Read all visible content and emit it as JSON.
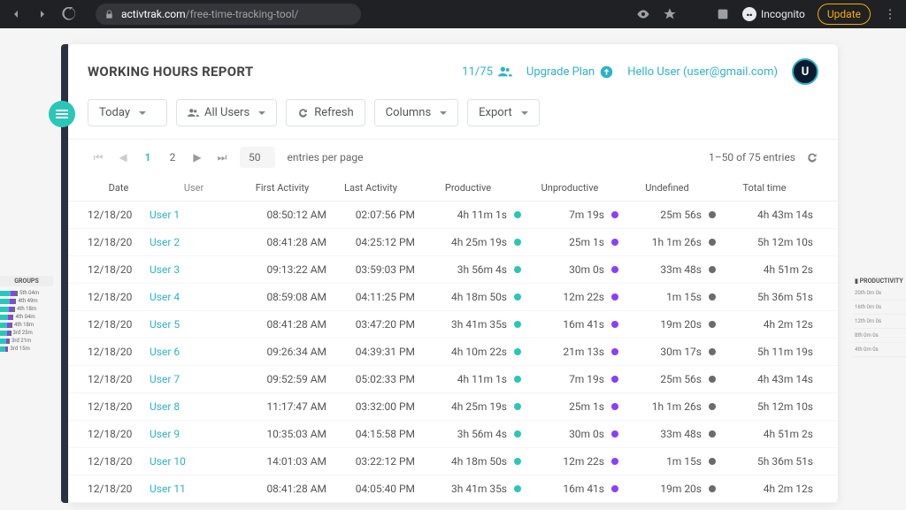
{
  "browser": {
    "url_domain": "activtrak.com",
    "url_path": "/free-time-tracking-tool/",
    "incognito": "Incognito",
    "update": "Update"
  },
  "header": {
    "title": "WORKING HOURS REPORT",
    "users_count": "11/75",
    "upgrade": "Upgrade Plan",
    "hello": "Hello User",
    "email": "(user@gmail.com)",
    "avatar_initial": "U"
  },
  "toolbar": {
    "timeframe": "Today",
    "users_filter": "All Users",
    "refresh": "Refresh",
    "columns": "Columns",
    "export": "Export"
  },
  "pager": {
    "page1": "1",
    "page2": "2",
    "per_page": "50",
    "per_page_label": "entries per page",
    "range": "1–50 of 75 entries"
  },
  "columns": {
    "date": "Date",
    "user": "User",
    "first": "First Activity",
    "last": "Last Activity",
    "productive": "Productive",
    "unproductive": "Unproductive",
    "undefined": "Undefined",
    "total": "Total time"
  },
  "rows": [
    {
      "date": "12/18/20",
      "user": "User 1",
      "first": "08:50:12 AM",
      "last": "02:07:56 PM",
      "prod": "4h 11m 1s",
      "unprod": "7m 19s",
      "undef": "25m 56s",
      "total": "4h 43m 14s"
    },
    {
      "date": "12/18/20",
      "user": "User 2",
      "first": "08:41:28 AM",
      "last": "04:25:12 PM",
      "prod": "4h 25m 19s",
      "unprod": "25m 1s",
      "undef": "1h 1m 26s",
      "total": "5h 12m 10s"
    },
    {
      "date": "12/18/20",
      "user": "User 3",
      "first": "09:13:22 AM",
      "last": "03:59:03 PM",
      "prod": "3h 56m 4s",
      "unprod": "30m 0s",
      "undef": "33m 48s",
      "total": "4h 51m 2s"
    },
    {
      "date": "12/18/20",
      "user": "User 4",
      "first": "08:59:08 AM",
      "last": "04:11:25 PM",
      "prod": "4h 18m 50s",
      "unprod": "12m 22s",
      "undef": "1m 15s",
      "total": "5h 36m 51s"
    },
    {
      "date": "12/18/20",
      "user": "User 5",
      "first": "08:41:28 AM",
      "last": "03:47:20 PM",
      "prod": "3h 41m 35s",
      "unprod": "16m 41s",
      "undef": "19m 20s",
      "total": "4h 2m 12s"
    },
    {
      "date": "12/18/20",
      "user": "User 6",
      "first": "09:26:34 AM",
      "last": "04:39:31 PM",
      "prod": "4h 10m 22s",
      "unprod": "21m 13s",
      "undef": "30m 17s",
      "total": "5h 11m 19s"
    },
    {
      "date": "12/18/20",
      "user": "User 7",
      "first": "09:52:59 AM",
      "last": "05:02:33 PM",
      "prod": "4h 11m 1s",
      "unprod": "7m 19s",
      "undef": "25m 56s",
      "total": "4h 43m 14s"
    },
    {
      "date": "12/18/20",
      "user": "User 8",
      "first": "11:17:47 AM",
      "last": "03:32:00 PM",
      "prod": "4h 25m 19s",
      "unprod": "25m 1s",
      "undef": "1h 1m 26s",
      "total": "5h 12m 10s"
    },
    {
      "date": "12/18/20",
      "user": "User 9",
      "first": "10:35:03 AM",
      "last": "04:15:58 PM",
      "prod": "3h 56m 4s",
      "unprod": "30m 0s",
      "undef": "33m 48s",
      "total": "4h 51m 2s"
    },
    {
      "date": "12/18/20",
      "user": "User 10",
      "first": "14:01:03 AM",
      "last": "03:22:12 PM",
      "prod": "4h 18m 50s",
      "unprod": "12m 22s",
      "undef": "1m 15s",
      "total": "5h 36m 51s"
    },
    {
      "date": "12/18/20",
      "user": "User 11",
      "first": "08:41:28 AM",
      "last": "04:05:40 PM",
      "prod": "3h 41m 35s",
      "unprod": "16m 41s",
      "undef": "19m 20s",
      "total": "4h 2m 12s"
    }
  ],
  "ghost_left": {
    "title": "GROUPS",
    "items": [
      "5th 04m",
      "4th 49m",
      "4th 18m",
      "4th 04m",
      "4th 18m",
      "3rd 25m",
      "3rd 21m",
      "3rd 15m"
    ]
  },
  "ghost_right": {
    "title": "PRODUCTIVITY",
    "items": [
      "20th 0m 0s",
      "16th 0m 0s",
      "12th 0m 0s",
      "8th 0m 0s",
      "4th 0m 0s"
    ]
  }
}
